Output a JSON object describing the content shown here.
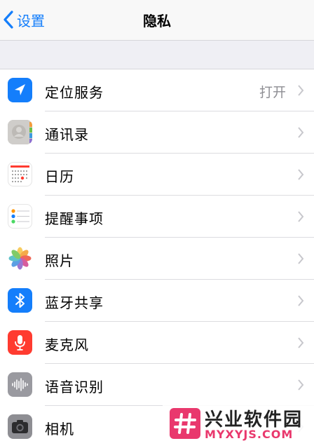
{
  "navbar": {
    "back_label": "设置",
    "title": "隐私"
  },
  "rows": [
    {
      "label": "定位服务",
      "value": "打开",
      "icon": "location-arrow-icon",
      "icon_bg": "#147efb"
    },
    {
      "label": "通讯录",
      "value": "",
      "icon": "contacts-icon",
      "icon_bg": "#d6d5d2"
    },
    {
      "label": "日历",
      "value": "",
      "icon": "calendar-icon",
      "icon_bg": "#ffffff"
    },
    {
      "label": "提醒事项",
      "value": "",
      "icon": "reminders-icon",
      "icon_bg": "#ffffff"
    },
    {
      "label": "照片",
      "value": "",
      "icon": "photos-flower-icon",
      "icon_bg": "#ffffff"
    },
    {
      "label": "蓝牙共享",
      "value": "",
      "icon": "bluetooth-icon",
      "icon_bg": "#147efb"
    },
    {
      "label": "麦克风",
      "value": "",
      "icon": "microphone-icon",
      "icon_bg": "#ff3b30"
    },
    {
      "label": "语音识别",
      "value": "",
      "icon": "speech-waveform-icon",
      "icon_bg": "#8e8e93"
    },
    {
      "label": "相机",
      "value": "",
      "icon": "camera-icon",
      "icon_bg": "#8e8e93"
    }
  ],
  "watermark": {
    "title": "兴业软件园",
    "subtitle": "MYXYJS.COM"
  },
  "colors": {
    "accent": "#147efb",
    "secondary_text": "#8e8e93",
    "background": "#efeff4"
  }
}
